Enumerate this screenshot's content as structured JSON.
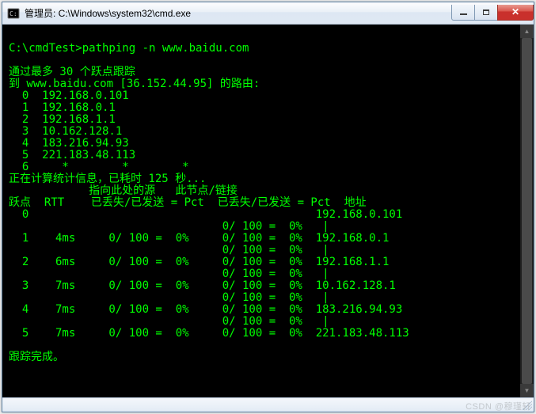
{
  "window": {
    "title": "管理员: C:\\Windows\\system32\\cmd.exe"
  },
  "terminal": {
    "prompt": "C:\\cmdTest>",
    "command": "pathping -n www.baidu.com",
    "lines": [
      "",
      "C:\\cmdTest>pathping -n www.baidu.com",
      "",
      "通过最多 30 个跃点跟踪",
      "到 www.baidu.com [36.152.44.95] 的路由:",
      "  0  192.168.0.101",
      "  1  192.168.0.1",
      "  2  192.168.1.1",
      "  3  10.162.128.1",
      "  4  183.216.94.93",
      "  5  221.183.48.113",
      "  6     *        *        *",
      "正在计算统计信息，已耗时 125 秒...",
      "            指向此处的源   此节点/链接",
      "跃点  RTT    已丢失/已发送 = Pct  已丢失/已发送 = Pct  地址",
      "  0                                           192.168.0.101",
      "                                0/ 100 =  0%   |",
      "  1    4ms     0/ 100 =  0%     0/ 100 =  0%  192.168.0.1",
      "                                0/ 100 =  0%   |",
      "  2    6ms     0/ 100 =  0%     0/ 100 =  0%  192.168.1.1",
      "                                0/ 100 =  0%   |",
      "  3    7ms     0/ 100 =  0%     0/ 100 =  0%  10.162.128.1",
      "                                0/ 100 =  0%   |",
      "  4    7ms     0/ 100 =  0%     0/ 100 =  0%  183.216.94.93",
      "                                0/ 100 =  0%   |",
      "  5    7ms     0/ 100 =  0%     0/ 100 =  0%  221.183.48.113",
      "",
      "跟踪完成。"
    ]
  },
  "watermark": "CSDN @穆瑾轩"
}
